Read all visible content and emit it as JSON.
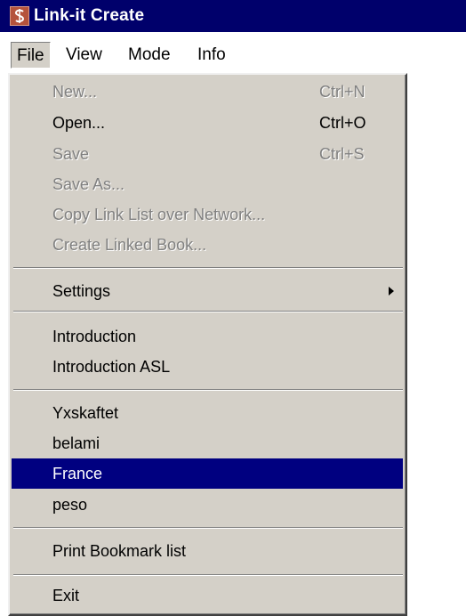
{
  "window": {
    "title": "Link-it Create",
    "icon": "app-logo-icon"
  },
  "menubar": {
    "items": [
      {
        "label": "File",
        "active": true
      },
      {
        "label": "View"
      },
      {
        "label": "Mode"
      },
      {
        "label": "Info"
      }
    ]
  },
  "file_menu": {
    "new": {
      "label": "New...",
      "shortcut": "Ctrl+N"
    },
    "open": {
      "label": "Open...",
      "shortcut": "Ctrl+O"
    },
    "save": {
      "label": "Save",
      "shortcut": "Ctrl+S"
    },
    "save_as": {
      "label": "Save As..."
    },
    "copy_link_list": {
      "label": "Copy Link List over Network..."
    },
    "create_linked_book": {
      "label": "Create Linked Book..."
    },
    "settings": {
      "label": "Settings"
    },
    "introduction": {
      "label": "Introduction"
    },
    "introduction_asl": {
      "label": "Introduction ASL"
    },
    "recent": [
      {
        "label": "Yxskaftet"
      },
      {
        "label": "belami"
      },
      {
        "label": "France",
        "selected": true
      },
      {
        "label": "peso"
      }
    ],
    "print_bookmark": {
      "label": "Print Bookmark list"
    },
    "exit": {
      "label": "Exit"
    }
  },
  "colors": {
    "titlebar": "#00006b",
    "menu_background": "#d4d0c8",
    "highlight": "#000080",
    "disabled_text": "#808080"
  }
}
